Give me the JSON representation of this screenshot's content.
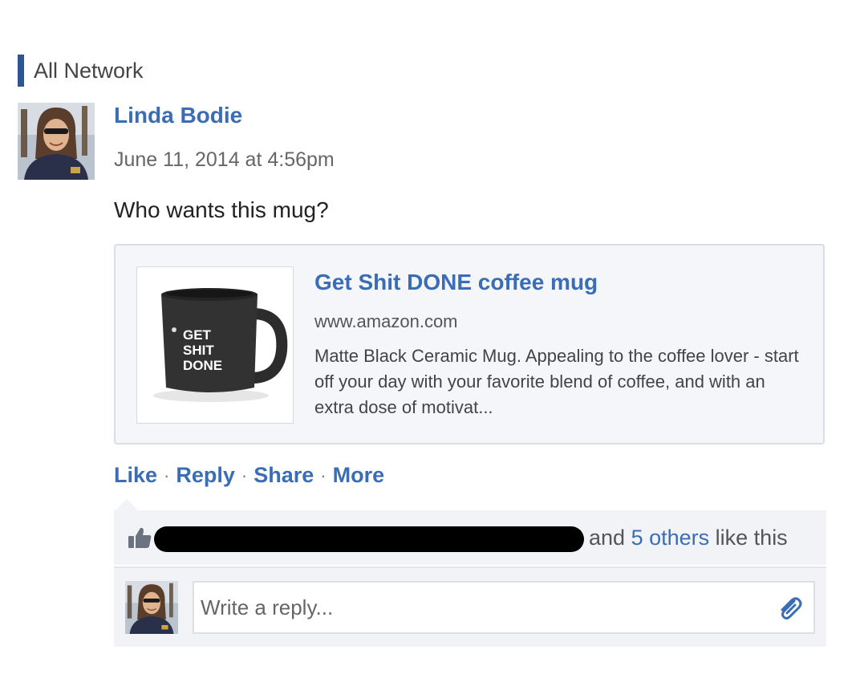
{
  "feed": {
    "title": "All Network",
    "accent_color": "#2f5597"
  },
  "post": {
    "author": "Linda Bodie",
    "timestamp": "June 11, 2014 at 4:56pm",
    "message": "Who wants this mug?",
    "link_card": {
      "title": "Get Shit DONE coffee mug",
      "domain": "www.amazon.com",
      "description": "Matte Black Ceramic Mug. Appealing to the coffee lover - start off your day with your favorite blend of coffee, and with an extra dose of motivat...",
      "thumbnail_text": [
        "GET",
        "SHIT",
        "DONE"
      ]
    },
    "actions": {
      "like": "Like",
      "reply": "Reply",
      "share": "Share",
      "more": "More",
      "separator": "·"
    },
    "likes": {
      "connector": "and",
      "others_link": "5 others",
      "suffix": "like this",
      "icon": "thumbs-up-icon"
    },
    "reply": {
      "placeholder": "Write a reply...",
      "attach_icon": "paperclip-icon"
    }
  },
  "colors": {
    "link_blue": "#3a6db5",
    "panel_bg": "#f2f3f6"
  }
}
